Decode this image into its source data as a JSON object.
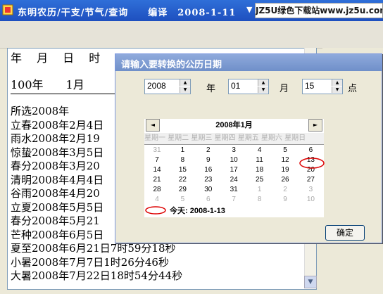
{
  "window": {
    "title": "东明农历/干支/节气/查询　　编译　2008-1-11",
    "menu_arrow": "▼",
    "watermark": "JZ5U绿色下载站www.jz5u.com"
  },
  "output": {
    "header": "年　 月　 日　 时",
    "first_line": "100年　　1月",
    "lines": [
      "所选2008年",
      "立春2008年2月4日",
      "雨水2008年2月19",
      "惊蛰2008年3月5日",
      "春分2008年3月20",
      "清明2008年4月4日",
      "谷雨2008年4月20",
      "立夏2008年5月5日",
      "春分2008年5月21",
      "芒种2008年6月5日",
      "夏至2008年6月21日7时59分18秒",
      "小暑2008年7月7日1时26分46秒",
      "大暑2008年7月22日18时54分44秒"
    ]
  },
  "dialog": {
    "title": "请输入要转换的公历日期",
    "year_value": "2008",
    "year_label": "年",
    "month_value": "01",
    "month_label": "月",
    "hour_value": "15",
    "hour_label": "点",
    "calendar": {
      "month_title": "2008年1月",
      "prev": "◄",
      "next": "►",
      "weekdays": "星期一 星期二 星期三 星期四 星期五 星期六 星期日",
      "weeks": [
        [
          "31",
          "1",
          "2",
          "3",
          "4",
          "5",
          "6"
        ],
        [
          "7",
          "8",
          "9",
          "10",
          "11",
          "12",
          "13"
        ],
        [
          "14",
          "15",
          "16",
          "17",
          "18",
          "19",
          "20"
        ],
        [
          "21",
          "22",
          "23",
          "24",
          "25",
          "26",
          "27"
        ],
        [
          "28",
          "29",
          "30",
          "31",
          "1",
          "2",
          "3"
        ],
        [
          "4",
          "5",
          "6",
          "7",
          "8",
          "9",
          "10"
        ]
      ],
      "today_label": "今天:  2008-1-13",
      "selected": "13"
    },
    "ok_label": "确定"
  }
}
